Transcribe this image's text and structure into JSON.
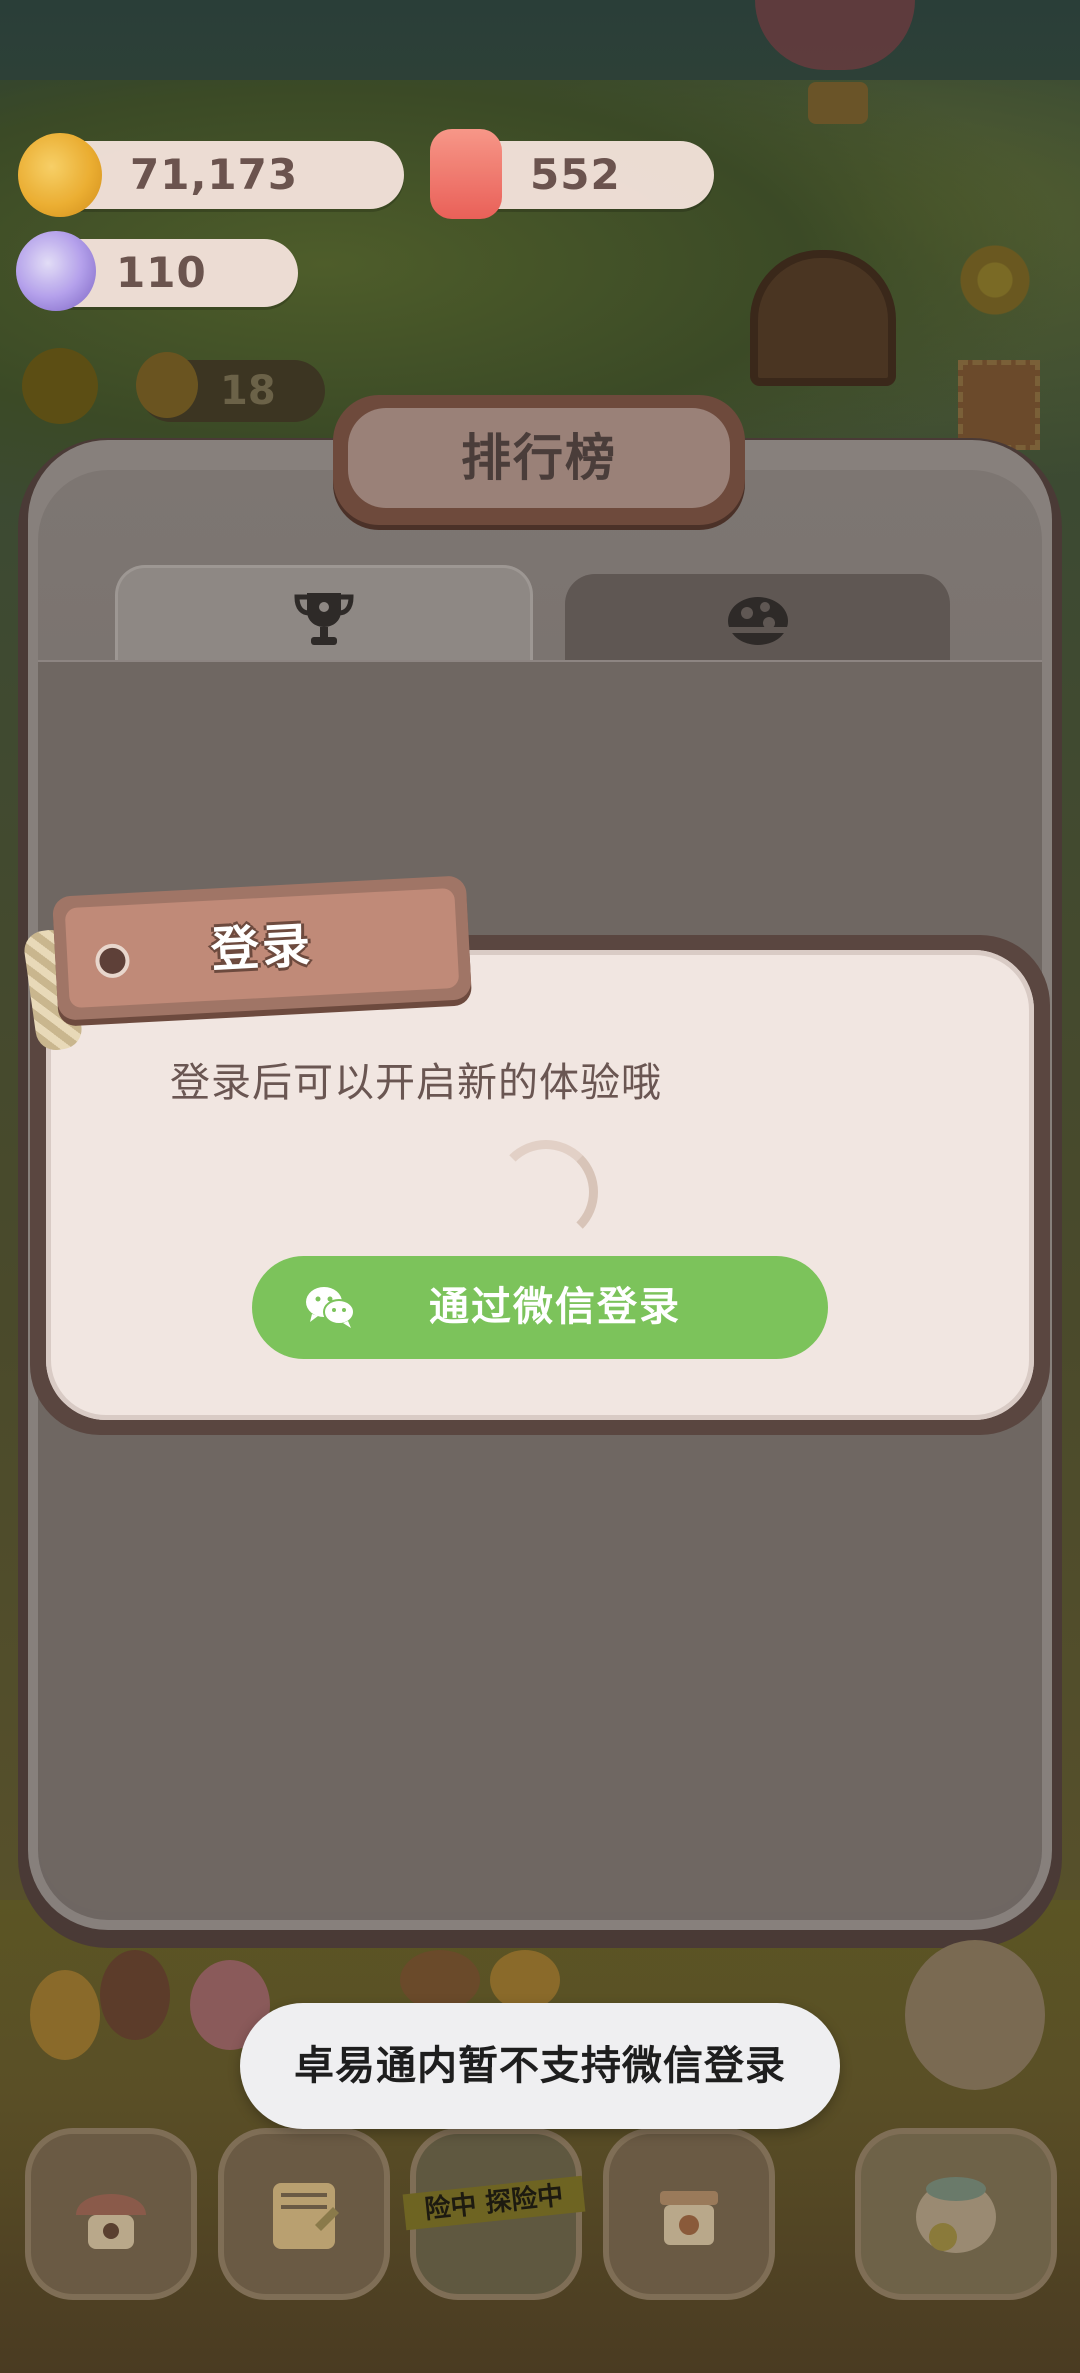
{
  "hud": {
    "cookies": "71,173",
    "candles": "552",
    "gems": "110",
    "bear_count": "18"
  },
  "leaderboard": {
    "title": "排行榜",
    "tabs": [
      {
        "name": "trophy-icon",
        "selected": true
      },
      {
        "name": "globe-icon",
        "selected": false
      }
    ]
  },
  "login_dialog": {
    "title": "登录",
    "message": "登录后可以开启新的体验哦",
    "wechat_button": "通过微信登录",
    "loading": true
  },
  "toast": {
    "text": "卓易通内暂不支持微信登录"
  },
  "bottom_nav": {
    "adventure_tape": "险中 探险中"
  },
  "colors": {
    "wechat_green": "#7cc35b",
    "dialog_bg": "#f1e6e1",
    "tag_brown": "#c08a78",
    "overlay_dim": "#6f6762"
  }
}
